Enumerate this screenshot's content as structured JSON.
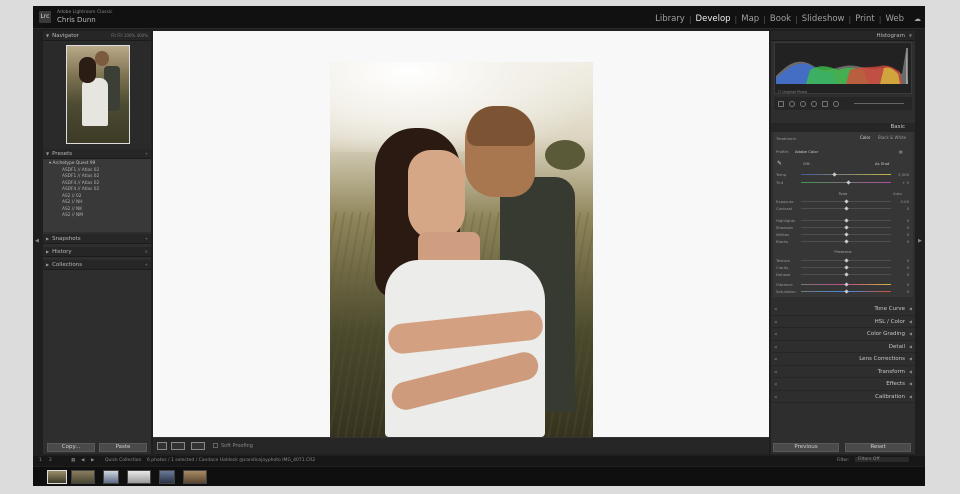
{
  "window": {
    "app_name": "Adobe Lightroom Classic",
    "user_name": "Chris Dunn",
    "logo": "Lrc"
  },
  "modules": [
    {
      "label": "Library",
      "active": false
    },
    {
      "label": "Develop",
      "active": true
    },
    {
      "label": "Map",
      "active": false
    },
    {
      "label": "Book",
      "active": false
    },
    {
      "label": "Slideshow",
      "active": false
    },
    {
      "label": "Print",
      "active": false
    },
    {
      "label": "Web",
      "active": false
    }
  ],
  "left_panel": {
    "navigator": {
      "title": "Navigator",
      "zoom_options": "Fit  Fill  100%  400%"
    },
    "presets": {
      "title": "Presets",
      "folder": "Archetype Quest 99",
      "items": [
        "ASDF1 // Atlas 02",
        "ASDF1 // Atlas 02",
        "ASDF4 // Atlas 02",
        "ASDF4 // Atlas 02",
        "AS2 // 02",
        "AS2 // NH",
        "AS2 // NK",
        "AS2 // NM"
      ]
    },
    "snapshots": {
      "title": "Snapshots"
    },
    "history": {
      "title": "History"
    },
    "collections": {
      "title": "Collections"
    },
    "copy_label": "Copy...",
    "paste_label": "Paste"
  },
  "toolbar": {
    "soft_proofing": "Soft Proofing"
  },
  "right_panel": {
    "histogram_title": "Histogram",
    "original_photo": "Original Photo",
    "basic": {
      "title": "Basic",
      "treatment_label": "Treatment:",
      "treatment_options": [
        "Color",
        "Black & White"
      ],
      "profile_label": "Profile:",
      "profile_value": "Adobe Color",
      "wb_label": "WB:",
      "wb_value": "As Shot",
      "temp_label": "Temp",
      "temp_value": "5,500",
      "tint_label": "Tint",
      "tint_value": "+ 5",
      "tone_label": "Tone",
      "tone_auto": "Auto",
      "exposure_label": "Exposure",
      "exposure_value": "0.00",
      "contrast_label": "Contrast",
      "contrast_value": "0",
      "highlights_label": "Highlights",
      "highlights_value": "0",
      "shadows_label": "Shadows",
      "shadows_value": "0",
      "whites_label": "Whites",
      "whites_value": "0",
      "blacks_label": "Blacks",
      "blacks_value": "0",
      "presence_label": "Presence",
      "texture_label": "Texture",
      "texture_value": "0",
      "clarity_label": "Clarity",
      "clarity_value": "0",
      "dehaze_label": "Dehaze",
      "dehaze_value": "0",
      "vibrance_label": "Vibrance",
      "vibrance_value": "0",
      "saturation_label": "Saturation",
      "saturation_value": "0"
    },
    "sections": [
      "Tone Curve",
      "HSL / Color",
      "Color Grading",
      "Detail",
      "Lens Corrections",
      "Transform",
      "Effects",
      "Calibration"
    ],
    "previous_label": "Previous",
    "reset_label": "Reset"
  },
  "filmstrip_bar": {
    "page_1": "1",
    "page_2": "2",
    "source": "Quick Collection",
    "info": "6 photos / 1 selected / Candace Haldeck @candicejoyphoto IMG_4071.CR2",
    "filter_label": "Filter:",
    "filter_value": "Filters Off"
  }
}
